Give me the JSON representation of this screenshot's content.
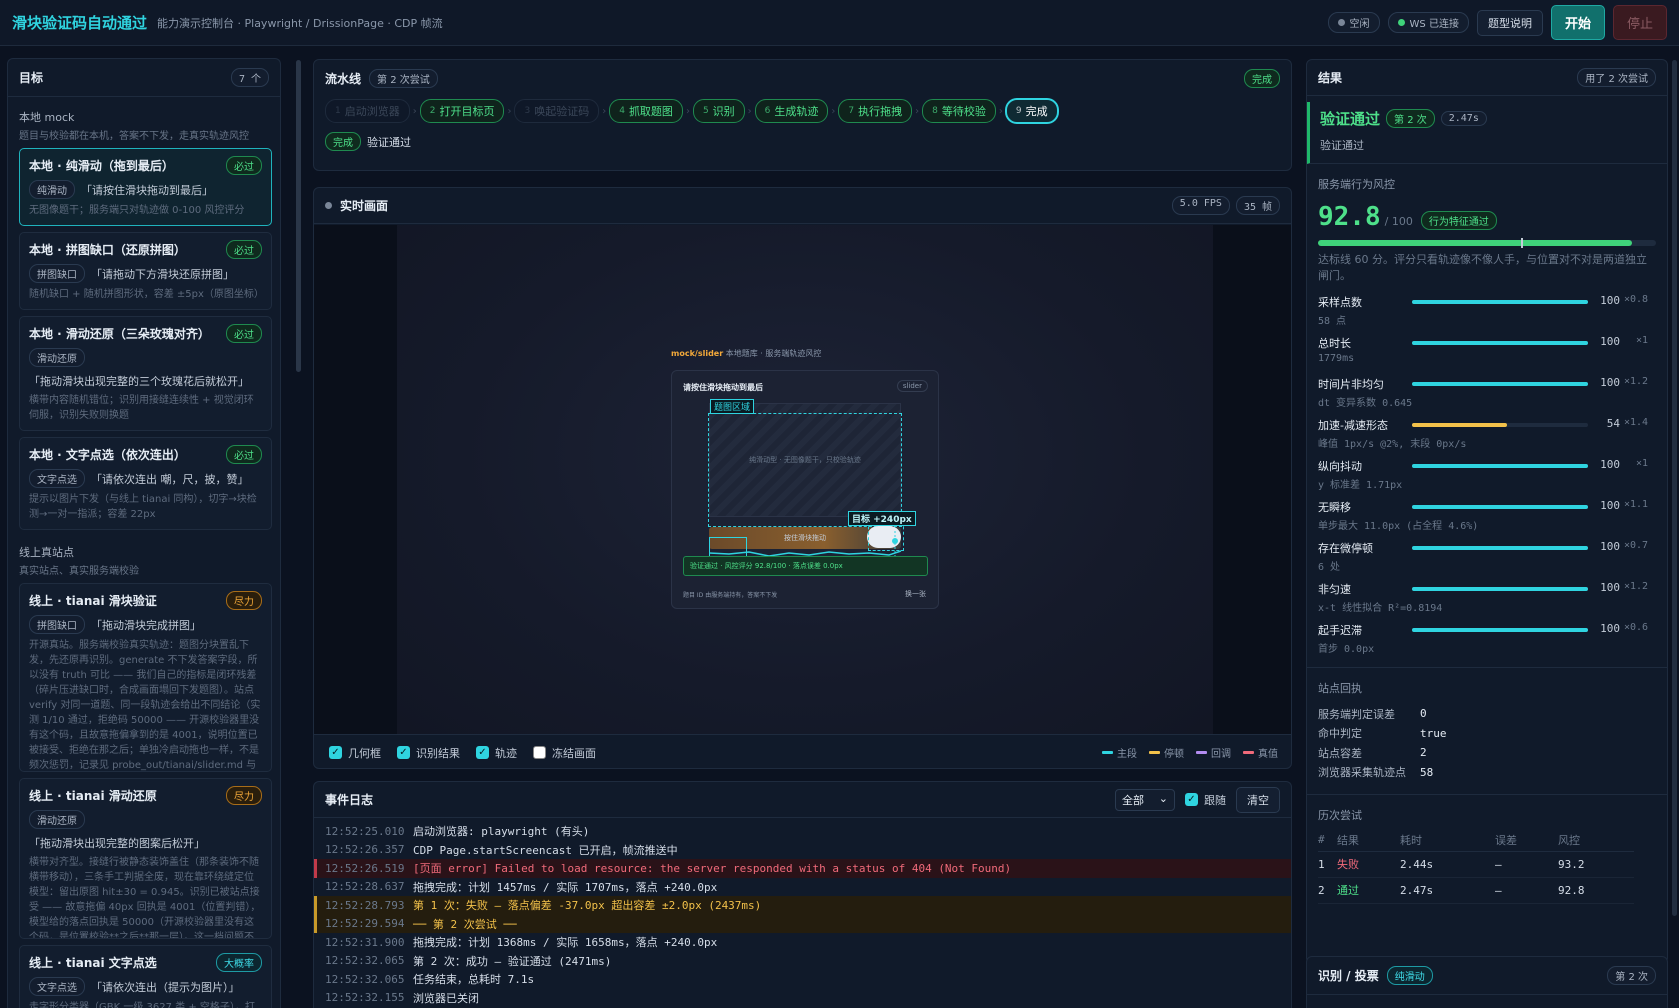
{
  "header": {
    "title": "滑块验证码自动通过",
    "subtitle": "能力演示控制台 · Playwright / DrissionPage · CDP 帧流",
    "status_idle": "空闲",
    "status_ws": "WS 已连接",
    "help_label": "题型说明",
    "start_label": "开始",
    "stop_label": "停止",
    "colors": {
      "accent": "#2fd4e0",
      "ok": "#4ee08a"
    }
  },
  "targets": {
    "title": "目标",
    "count": "7 个",
    "local_group": {
      "name": "本地 mock",
      "desc": "题目与校验都在本机，答案不下发，走真实轨迹风控"
    },
    "local": [
      {
        "title": "本地 · 纯滑动（拖到最后）",
        "badge": "必过",
        "type": "纯滑动",
        "prompt": "「请按住滑块拖动到最后」",
        "desc": "无图像题干；服务端只对轨迹做 0-100 风控评分"
      },
      {
        "title": "本地 · 拼图缺口（还原拼图）",
        "badge": "必过",
        "type": "拼图缺口",
        "prompt": "「请拖动下方滑块还原拼图」",
        "desc": "随机缺口 + 随机拼图形状，容差 ±5px（原图坐标）"
      },
      {
        "title": "本地 · 滑动还原（三朵玫瑰对齐）",
        "badge": "必过",
        "type": "滑动还原",
        "prompt": "「拖动滑块出现完整的三个玫瑰花后就松开」",
        "desc": "横带内容随机错位；识别用接缝连续性 + 视觉闭环伺服，识别失败则换题"
      },
      {
        "title": "本地 · 文字点选（依次连出）",
        "badge": "必过",
        "type": "文字点选",
        "prompt": "「请依次连出 嘲，尺，披，赞」",
        "desc": "提示以图片下发（与线上 tianai 同构），切字→块检测→一对一指派；容差 22px"
      }
    ],
    "online_group": {
      "name": "线上真站点",
      "desc": "真实站点、真实服务端校验"
    },
    "online": [
      {
        "title": "线上 · tianai 滑块验证",
        "badge": "尽力",
        "type": "拼图缺口",
        "prompt": "「拖动滑块完成拼图」",
        "desc": "开源真站。服务端校验真实轨迹：题图分块置乱下发，先还原再识别。generate 不下发答案字段，所以没有 truth 可比 —— 我们自己的指标是闭环残差（碎片压进缺口时，合成画面塌回下发题图）。站点 verify 对同一道题、同一段轨迹会给出不同结论（实测 1/10 通过，拒绝码 50000 —— 开源校验器里没有这个码，且故意拖偏拿到的是 4001，说明位置已被接受、拒绝在那之后；单独冷启动拖也一样，不是频次惩罚，记录见 probe_out/tianai/slider.md 与 model.md §5），所以这一档按 best-effort 计。"
      },
      {
        "title": "线上 · tianai 滑动还原",
        "badge": "尽力",
        "type": "滑动还原",
        "prompt": "「拖动滑块出现完整的图案后松开」",
        "desc": "横带对齐型。接缝行被静态装饰盖住（那条装饰不随横带移动），三条手工判据全废，现在靠环绕缝定位模型：留出原图 hit±30 = 0.945。识别已被站点接受 —— 故意拖偏 40px 回执是 4001（位置判错），模型给的落点回执是 50000（开源校验器里没有这个码，是位置校验**之后**那一层）。这一档问题不在于不是识别的问题，见 probe_out/model.md §5"
      },
      {
        "title": "线上 · tianai 文字点选",
        "badge": "大概率",
        "type": "文字点选",
        "prompt": "「请依次连出（提示为图片）」",
        "desc": "走字形分类器（GBK 一级 3627 类 + 空格子），打分是两块图'是同一个字'的概率，不要求任何一边单"
      }
    ]
  },
  "pipeline": {
    "title": "流水线",
    "attempt": "第 2 次尝试",
    "status": "完成",
    "steps": [
      {
        "n": "1",
        "label": "启动浏览器",
        "state": "dim"
      },
      {
        "n": "2",
        "label": "打开目标页",
        "state": "done"
      },
      {
        "n": "3",
        "label": "唤起验证码",
        "state": "dim"
      },
      {
        "n": "4",
        "label": "抓取题图",
        "state": "done"
      },
      {
        "n": "5",
        "label": "识别",
        "state": "done"
      },
      {
        "n": "6",
        "label": "生成轨迹",
        "state": "done"
      },
      {
        "n": "7",
        "label": "执行拖拽",
        "state": "done"
      },
      {
        "n": "8",
        "label": "等待校验",
        "state": "done"
      },
      {
        "n": "9",
        "label": "完成",
        "state": "cur"
      }
    ],
    "result_tag": "完成",
    "result_text": "验证通过"
  },
  "live": {
    "title": "实时画面",
    "fps": "5.0 FPS",
    "frames": "35 帧",
    "mock": {
      "brand": "mock/slider",
      "brand_sub": "本地题库 · 服务端轨迹风控",
      "prompt": "请按住滑块拖动到最后",
      "type": "slider",
      "region_label": "题图区域",
      "image_text": "纯滑动型 · 无图像题干，只校验轨迹",
      "target_label": "目标 +240px",
      "track_text": "按住滑块拖动",
      "success_text": "验证通过 · 风控评分 92.8/100 · 落点误差 0.0px",
      "footer": "题目 ID 由服务端持有，答案不下发",
      "refresh": "换一张"
    },
    "checks": [
      {
        "label": "几何框",
        "on": true
      },
      {
        "label": "识别结果",
        "on": true
      },
      {
        "label": "轨迹",
        "on": true
      },
      {
        "label": "冻结画面",
        "on": false
      }
    ],
    "legend": [
      {
        "label": "主段",
        "color": "#2fd4e0"
      },
      {
        "label": "停顿",
        "color": "#f2c14a"
      },
      {
        "label": "回调",
        "color": "#b38cf0"
      },
      {
        "label": "真值",
        "color": "#f06a7a"
      }
    ]
  },
  "events": {
    "title": "事件日志",
    "filter": "全部",
    "follow_label": "跟随",
    "clear_label": "清空",
    "rows": [
      {
        "t": "12:52:25.010",
        "msg": "启动浏览器: playwright (有头)",
        "level": "info"
      },
      {
        "t": "12:52:26.357",
        "msg": "CDP Page.startScreencast 已开启，帧流推送中",
        "level": "info"
      },
      {
        "t": "12:52:26.519",
        "msg": "[页面 error] Failed to load resource: the server responded with a status of 404 (Not Found)",
        "level": "err"
      },
      {
        "t": "12:52:28.637",
        "msg": "拖拽完成：计划 1457ms / 实际 1707ms，落点 +240.0px",
        "level": "info"
      },
      {
        "t": "12:52:28.793",
        "msg": "第 1 次：失败 — 落点偏差 -37.0px 超出容差 ±2.0px (2437ms)",
        "level": "warn"
      },
      {
        "t": "12:52:29.594",
        "msg": "── 第 2 次尝试 ──",
        "level": "warn"
      },
      {
        "t": "12:52:31.900",
        "msg": "拖拽完成：计划 1368ms / 实际 1658ms，落点 +240.0px",
        "level": "info"
      },
      {
        "t": "12:52:32.065",
        "msg": "第 2 次：成功 — 验证通过 (2471ms)",
        "level": "info"
      },
      {
        "t": "12:52:32.065",
        "msg": "任务结束，总耗时 7.1s",
        "level": "info"
      },
      {
        "t": "12:52:32.155",
        "msg": "浏览器已关闭",
        "level": "info"
      }
    ]
  },
  "results": {
    "title": "结果",
    "used": "用了 2 次尝试",
    "pass_label": "验证通过",
    "pass_attempt": "第 2 次",
    "pass_time": "2.47s",
    "pass_sub": "验证通过",
    "risk_label": "服务端行为风控",
    "score": "92.8",
    "score_max": "/ 100",
    "score_tag": "行为特征通过",
    "score_value": 92.8,
    "threshold_value": 60,
    "note": "达标线 60 分。评分只看轨迹像不像人手，与位置对不对是两道独立闸门。",
    "metrics": [
      {
        "name": "采样点数",
        "detail": "58 点",
        "value": "100",
        "weight": "×0.8",
        "fill": 100,
        "color": "#2fd4e0"
      },
      {
        "name": "总时长",
        "detail": "1779ms",
        "value": "100",
        "weight": "×1",
        "fill": 100,
        "color": "#2fd4e0"
      },
      {
        "name": "时间片非均匀",
        "detail": "dt 变异系数 0.645",
        "value": "100",
        "weight": "×1.2",
        "fill": 100,
        "color": "#2fd4e0"
      },
      {
        "name": "加速-减速形态",
        "detail": "峰值 1px/s @2%, 末段 0px/s",
        "value": "54",
        "weight": "×1.4",
        "fill": 54,
        "color": "#f2c14a"
      },
      {
        "name": "纵向抖动",
        "detail": "y 标准差 1.71px",
        "value": "100",
        "weight": "×1",
        "fill": 100,
        "color": "#2fd4e0"
      },
      {
        "name": "无瞬移",
        "detail": "单步最大 11.0px (占全程 4.6%)",
        "value": "100",
        "weight": "×1.1",
        "fill": 100,
        "color": "#2fd4e0"
      },
      {
        "name": "存在微停顿",
        "detail": "6 处",
        "value": "100",
        "weight": "×0.7",
        "fill": 100,
        "color": "#2fd4e0"
      },
      {
        "name": "非匀速",
        "detail": "x-t 线性拟合 R²=0.8194",
        "value": "100",
        "weight": "×1.2",
        "fill": 100,
        "color": "#2fd4e0"
      },
      {
        "name": "起手迟滞",
        "detail": "首步 0.0px",
        "value": "100",
        "weight": "×0.6",
        "fill": 100,
        "color": "#2fd4e0"
      }
    ],
    "receipt_label": "站点回执",
    "receipt": [
      {
        "k": "服务端判定误差",
        "v": "0"
      },
      {
        "k": "命中判定",
        "v": "true"
      },
      {
        "k": "站点容差",
        "v": "2"
      },
      {
        "k": "浏览器采集轨迹点",
        "v": "58"
      }
    ],
    "history_label": "历次尝试",
    "history_headers": [
      "#",
      "结果",
      "耗时",
      "误差",
      "风控"
    ],
    "history": [
      {
        "n": "1",
        "result": "失败",
        "ok": false,
        "time": "2.44s",
        "err": "—",
        "risk": "93.2"
      },
      {
        "n": "2",
        "result": "通过",
        "ok": true,
        "time": "2.47s",
        "err": "—",
        "risk": "92.8"
      }
    ]
  },
  "vote": {
    "title": "识别 / 投票",
    "tag": "纯滑动",
    "count": "第 2 次"
  }
}
